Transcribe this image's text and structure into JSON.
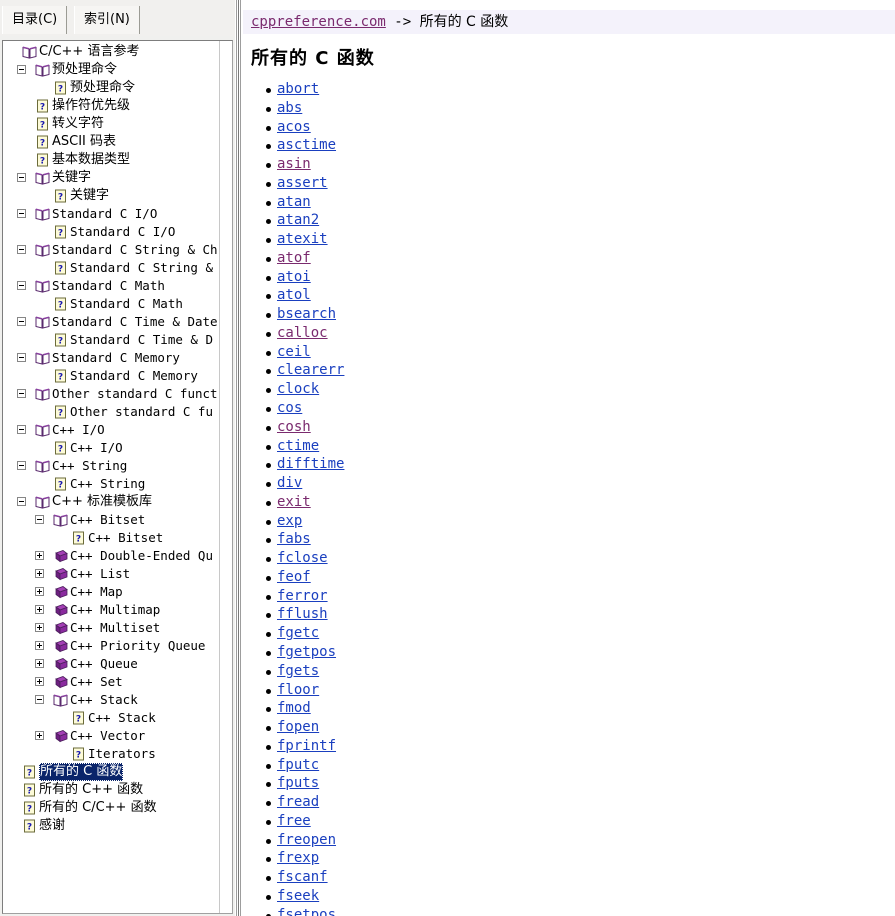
{
  "tabs": [
    {
      "label": "目录(C)",
      "name": "tab-catalog",
      "selected": true
    },
    {
      "label": "索引(N)",
      "name": "tab-index",
      "selected": false
    }
  ],
  "tree": {
    "nodes": [
      {
        "label": "C/C++ 语言参考",
        "indent": 0,
        "icon": "book-open",
        "twisty": "none",
        "cjk": true,
        "selected": false
      },
      {
        "label": "预处理命令",
        "indent": 1,
        "icon": "book-open",
        "twisty": "minus",
        "cjk": true,
        "selected": false
      },
      {
        "label": "预处理命令",
        "indent": 2,
        "icon": "page",
        "twisty": "none",
        "cjk": true,
        "selected": false
      },
      {
        "label": "操作符优先级",
        "indent": 1,
        "icon": "page",
        "twisty": "none",
        "cjk": true,
        "selected": false
      },
      {
        "label": "转义字符",
        "indent": 1,
        "icon": "page",
        "twisty": "none",
        "cjk": true,
        "selected": false
      },
      {
        "label": "ASCII 码表",
        "indent": 1,
        "icon": "page",
        "twisty": "none",
        "cjk": true,
        "selected": false
      },
      {
        "label": "基本数据类型",
        "indent": 1,
        "icon": "page",
        "twisty": "none",
        "cjk": true,
        "selected": false
      },
      {
        "label": "关键字",
        "indent": 1,
        "icon": "book-open",
        "twisty": "minus",
        "cjk": true,
        "selected": false
      },
      {
        "label": "关键字",
        "indent": 2,
        "icon": "page",
        "twisty": "none",
        "cjk": true,
        "selected": false
      },
      {
        "label": "Standard C I/O",
        "indent": 1,
        "icon": "book-open",
        "twisty": "minus",
        "cjk": false,
        "selected": false
      },
      {
        "label": "Standard C I/O",
        "indent": 2,
        "icon": "page",
        "twisty": "none",
        "cjk": false,
        "selected": false
      },
      {
        "label": "Standard C String & Ch",
        "indent": 1,
        "icon": "book-open",
        "twisty": "minus",
        "cjk": false,
        "selected": false
      },
      {
        "label": "Standard C String &",
        "indent": 2,
        "icon": "page",
        "twisty": "none",
        "cjk": false,
        "selected": false
      },
      {
        "label": "Standard C Math",
        "indent": 1,
        "icon": "book-open",
        "twisty": "minus",
        "cjk": false,
        "selected": false
      },
      {
        "label": "Standard C Math",
        "indent": 2,
        "icon": "page",
        "twisty": "none",
        "cjk": false,
        "selected": false
      },
      {
        "label": "Standard C Time & Date",
        "indent": 1,
        "icon": "book-open",
        "twisty": "minus",
        "cjk": false,
        "selected": false
      },
      {
        "label": "Standard C Time & D",
        "indent": 2,
        "icon": "page",
        "twisty": "none",
        "cjk": false,
        "selected": false
      },
      {
        "label": "Standard C Memory",
        "indent": 1,
        "icon": "book-open",
        "twisty": "minus",
        "cjk": false,
        "selected": false
      },
      {
        "label": "Standard C Memory",
        "indent": 2,
        "icon": "page",
        "twisty": "none",
        "cjk": false,
        "selected": false
      },
      {
        "label": "Other standard C funct",
        "indent": 1,
        "icon": "book-open",
        "twisty": "minus",
        "cjk": false,
        "selected": false
      },
      {
        "label": "Other standard C fu",
        "indent": 2,
        "icon": "page",
        "twisty": "none",
        "cjk": false,
        "selected": false
      },
      {
        "label": "C++ I/O",
        "indent": 1,
        "icon": "book-open",
        "twisty": "minus",
        "cjk": false,
        "selected": false
      },
      {
        "label": "C++ I/O",
        "indent": 2,
        "icon": "page",
        "twisty": "none",
        "cjk": false,
        "selected": false
      },
      {
        "label": "C++ String",
        "indent": 1,
        "icon": "book-open",
        "twisty": "minus",
        "cjk": false,
        "selected": false
      },
      {
        "label": "C++ String",
        "indent": 2,
        "icon": "page",
        "twisty": "none",
        "cjk": false,
        "selected": false
      },
      {
        "label": "C++ 标准模板库",
        "indent": 1,
        "icon": "book-open",
        "twisty": "minus",
        "cjk": true,
        "selected": false
      },
      {
        "label": "C++ Bitset",
        "indent": 2,
        "icon": "book-open",
        "twisty": "minus",
        "cjk": false,
        "selected": false
      },
      {
        "label": "C++ Bitset",
        "indent": 3,
        "icon": "page",
        "twisty": "none",
        "cjk": false,
        "selected": false
      },
      {
        "label": "C++ Double-Ended Qu",
        "indent": 2,
        "icon": "book-closed",
        "twisty": "plus",
        "cjk": false,
        "selected": false
      },
      {
        "label": "C++ List",
        "indent": 2,
        "icon": "book-closed",
        "twisty": "plus",
        "cjk": false,
        "selected": false
      },
      {
        "label": "C++ Map",
        "indent": 2,
        "icon": "book-closed",
        "twisty": "plus",
        "cjk": false,
        "selected": false
      },
      {
        "label": "C++ Multimap",
        "indent": 2,
        "icon": "book-closed",
        "twisty": "plus",
        "cjk": false,
        "selected": false
      },
      {
        "label": "C++ Multiset",
        "indent": 2,
        "icon": "book-closed",
        "twisty": "plus",
        "cjk": false,
        "selected": false
      },
      {
        "label": "C++ Priority Queue",
        "indent": 2,
        "icon": "book-closed",
        "twisty": "plus",
        "cjk": false,
        "selected": false
      },
      {
        "label": "C++ Queue",
        "indent": 2,
        "icon": "book-closed",
        "twisty": "plus",
        "cjk": false,
        "selected": false
      },
      {
        "label": "C++ Set",
        "indent": 2,
        "icon": "book-closed",
        "twisty": "plus",
        "cjk": false,
        "selected": false
      },
      {
        "label": "C++ Stack",
        "indent": 2,
        "icon": "book-open",
        "twisty": "minus",
        "cjk": false,
        "selected": false
      },
      {
        "label": "C++ Stack",
        "indent": 3,
        "icon": "page",
        "twisty": "none",
        "cjk": false,
        "selected": false
      },
      {
        "label": "C++ Vector",
        "indent": 2,
        "icon": "book-closed",
        "twisty": "plus",
        "cjk": false,
        "selected": false
      },
      {
        "label": "Iterators",
        "indent": 3,
        "icon": "page",
        "twisty": "none",
        "cjk": false,
        "selected": false
      },
      {
        "label": "所有的 C 函数",
        "indent": 0,
        "icon": "page",
        "twisty": "none",
        "cjk": true,
        "selected": true
      },
      {
        "label": "所有的 C++ 函数",
        "indent": 0,
        "icon": "page",
        "twisty": "none",
        "cjk": true,
        "selected": false
      },
      {
        "label": "所有的 C/C++ 函数",
        "indent": 0,
        "icon": "page",
        "twisty": "none",
        "cjk": true,
        "selected": false
      },
      {
        "label": "感谢",
        "indent": 0,
        "icon": "page",
        "twisty": "none",
        "cjk": true,
        "selected": false
      }
    ]
  },
  "content": {
    "breadcrumb": {
      "site": "cppreference.com",
      "separator": "->",
      "current": "所有的 C 函数"
    },
    "title": "所有的 C 函数",
    "functions": [
      {
        "name": "abort",
        "visited": false
      },
      {
        "name": "abs",
        "visited": false
      },
      {
        "name": "acos",
        "visited": false
      },
      {
        "name": "asctime",
        "visited": false
      },
      {
        "name": "asin",
        "visited": true
      },
      {
        "name": "assert",
        "visited": false
      },
      {
        "name": "atan",
        "visited": false
      },
      {
        "name": "atan2",
        "visited": false
      },
      {
        "name": "atexit",
        "visited": false
      },
      {
        "name": "atof",
        "visited": true
      },
      {
        "name": "atoi",
        "visited": false
      },
      {
        "name": "atol",
        "visited": false
      },
      {
        "name": "bsearch",
        "visited": false
      },
      {
        "name": "calloc",
        "visited": true
      },
      {
        "name": "ceil",
        "visited": false
      },
      {
        "name": "clearerr",
        "visited": false
      },
      {
        "name": "clock",
        "visited": false
      },
      {
        "name": "cos",
        "visited": false
      },
      {
        "name": "cosh",
        "visited": true
      },
      {
        "name": "ctime",
        "visited": false
      },
      {
        "name": "difftime",
        "visited": false
      },
      {
        "name": "div",
        "visited": false
      },
      {
        "name": "exit",
        "visited": true
      },
      {
        "name": "exp",
        "visited": false
      },
      {
        "name": "fabs",
        "visited": false
      },
      {
        "name": "fclose",
        "visited": false
      },
      {
        "name": "feof",
        "visited": false
      },
      {
        "name": "ferror",
        "visited": false
      },
      {
        "name": "fflush",
        "visited": false
      },
      {
        "name": "fgetc",
        "visited": false
      },
      {
        "name": "fgetpos",
        "visited": false
      },
      {
        "name": "fgets",
        "visited": false
      },
      {
        "name": "floor",
        "visited": false
      },
      {
        "name": "fmod",
        "visited": false
      },
      {
        "name": "fopen",
        "visited": false
      },
      {
        "name": "fprintf",
        "visited": false
      },
      {
        "name": "fputc",
        "visited": false
      },
      {
        "name": "fputs",
        "visited": false
      },
      {
        "name": "fread",
        "visited": false
      },
      {
        "name": "free",
        "visited": false
      },
      {
        "name": "freopen",
        "visited": false
      },
      {
        "name": "frexp",
        "visited": false
      },
      {
        "name": "fscanf",
        "visited": false
      },
      {
        "name": "fseek",
        "visited": false
      },
      {
        "name": "fsetpos",
        "visited": false
      }
    ]
  },
  "colors": {
    "link": "#1a3fbf",
    "link_visited": "#7a2a6e",
    "selection_bg": "#0a246a",
    "breadcrumb_bg": "#f4f2fb"
  }
}
